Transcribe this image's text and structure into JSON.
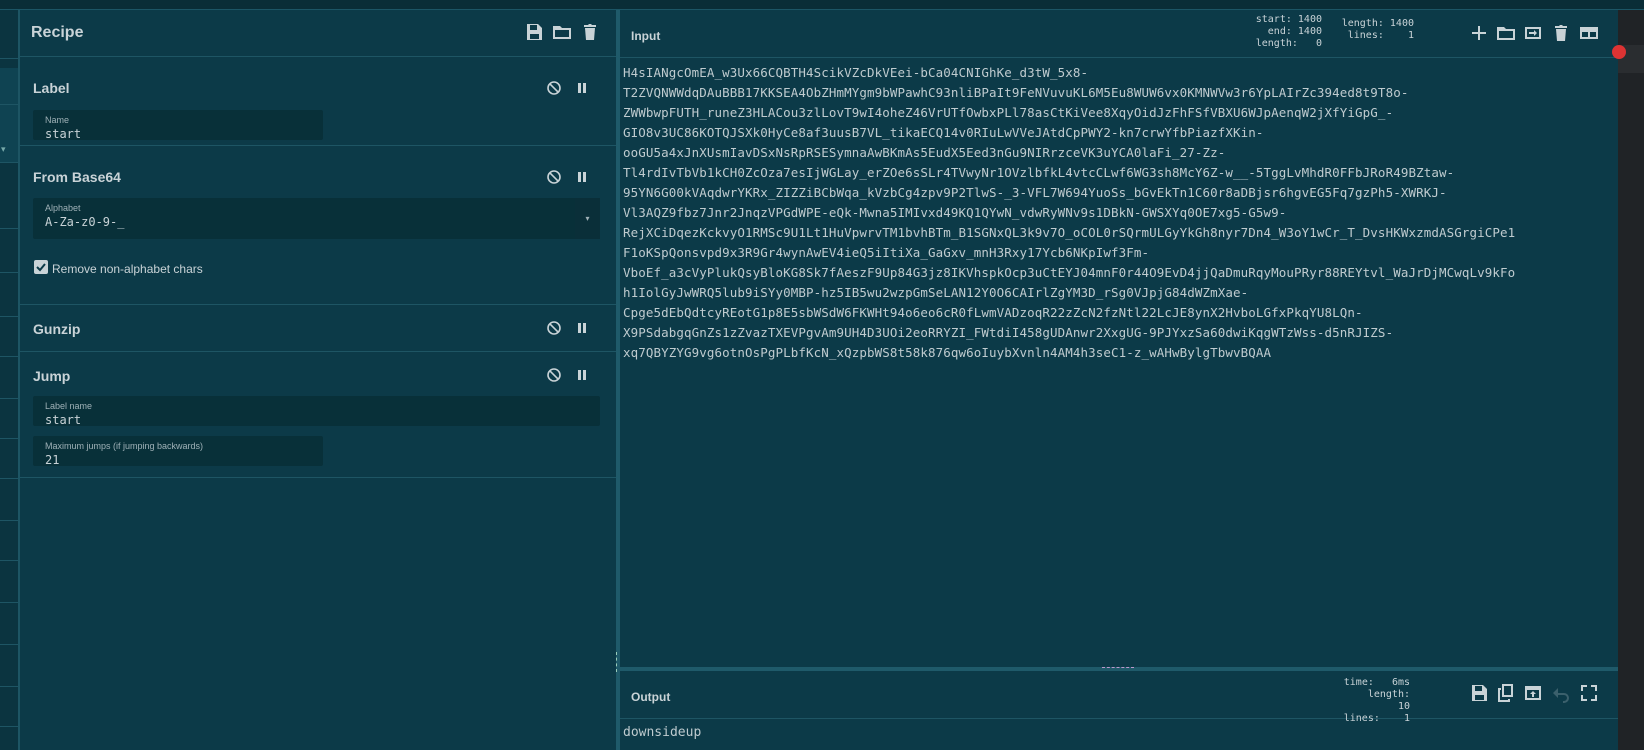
{
  "top": {
    "text_center": "…",
    "text_right": "…"
  },
  "recipe": {
    "title": "Recipe",
    "header_icons": [
      "save-icon",
      "folder-icon",
      "trash-icon"
    ],
    "operations": [
      {
        "title": "Label",
        "fields": [
          {
            "label": "Name",
            "value": "start"
          }
        ]
      },
      {
        "title": "From Base64",
        "fields": [
          {
            "label": "Alphabet",
            "value": "A-Za-z0-9-_"
          }
        ],
        "checkbox": {
          "label": "Remove non-alphabet chars",
          "checked": true
        }
      },
      {
        "title": "Gunzip",
        "fields": []
      },
      {
        "title": "Jump",
        "fields": [
          {
            "label": "Label name",
            "value": "start"
          },
          {
            "label": "Maximum jumps (if jumping backwards)",
            "value": "21"
          }
        ]
      }
    ]
  },
  "input": {
    "title": "Input",
    "stats": {
      "start_label": "start:",
      "start": "1400",
      "end_label": "end:",
      "end": "1400",
      "length_label": "length:",
      "length": "0",
      "total_length_label": "length:",
      "total_length": "1400",
      "lines_label": "lines:",
      "lines": "1"
    },
    "text_lines": [
      "H4sIANgcOmEA_w3Ux66CQBTH4ScikVZcDkVEei-bCa04CNIGhKe_d3tW_5x8-",
      "T2ZVQNWWdqDAuBBB17KKSEA4ObZHmMYgm9bWPawhC93nliBPaIt9FeNVuvuKL6M5Eu8WUW6vx0KMNWVw3r6YpLAIrZc394ed8t9T8o-",
      "ZWWbwpFUTH_runeZ3HLACou3zlLovT9wI4oheZ46VrUTfOwbxPLl78asCtKiVee8XqyOidJzFhFSfVBXU6WJpAenqW2jXfYiGpG_-",
      "GIO8v3UC86KOTQJSXk0HyCe8af3uusB7VL_tikaECQ14v0RIuLwVVeJAtdCpPWY2-kn7crwYfbPiazfXKin-",
      "ooGU5a4xJnXUsmIavDSxNsRpRSESymnaAwBKmAs5EudX5Eed3nGu9NIRrzceVK3uYCA0laFi_27-Zz-",
      "Tl4rdIvTbVb1kCH0ZcOza7esIjWGLay_erZOe6sSLr4TVwyNr1OVzlbfkL4vtcCLwf6WG3sh8McY6Z-w__-5TggLvMhdR0FFbJRoR49BZtaw-",
      "95YN6G00kVAqdwrYKRx_ZIZZiBCbWqa_kVzbCg4zpv9P2TlwS-_3-VFL7W694YuoSs_bGvEkTn1C60r8aDBjsr6hgvEG5Fq7gzPh5-XWRKJ-",
      "Vl3AQZ9fbz7Jnr2JnqzVPGdWPE-eQk-Mwna5IMIvxd49KQ1QYwN_vdwRyWNv9s1DBkN-GWSXYq0OE7xg5-G5w9-",
      "RejXCiDqezKckvyO1RMSc9U1Lt1HuVpwrvTM1bvhBTm_B1SGNxQL3k9v7O_oCOL0rSQrmULGyYkGh8nyr7Dn4_W3oY1wCr_T_DvsHKWxzmdASGrgiCPe1",
      "F1oKSpQonsvpd9x3R9Gr4wynAwEV4ieQ5iItiXa_GaGxv_mnH3Rxy17Ycb6NKpIwf3Fm-",
      "VboEf_a3cVyPlukQsyBloKG8Sk7fAeszF9Up84G3jz8IKVhspkOcp3uCtEYJ04mnF0r44O9EvD4jjQaDmuRqyMouPRyr88REYtvl_WaJrDjMCwqLv9kFo",
      "h1IolGyJwWRQ5lub9iSYy0MBP-hz5IB5wu2wzpGmSeLAN12Y0O6CAIrlZgYM3D_rSg0VJpjG84dWZmXae-",
      "Cpge5dEbQdtcyREotG1p8E5sbWSdW6FKWHt94o6eo6cR0fLwmVADzoqR22zZcN2fzNtl22LcJE8ynX2HvboLGfxPkqYU8LQn-",
      "X9PSdabgqGnZs1zZvazTXEVPgvAm9UH4D3UOi2eoRRYZI_FWtdiI458gUDAnwr2XxgUG-9PJYxzSa60dwiKqgWTzWss-d5nRJIZS-",
      "xq7QBYZYG9vg6otnOsPgPLbfKcN_xQzpbWS8t58k876qw6oIuybXvnln4AM4h3seC1-z_wAHwBylgTbwvBQAA"
    ]
  },
  "output": {
    "title": "Output",
    "stats": {
      "time_label": "time:",
      "time": "6ms",
      "length_label": "length:",
      "length": "10",
      "lines_label": "lines:",
      "lines": "1"
    },
    "text": "downsideup"
  }
}
